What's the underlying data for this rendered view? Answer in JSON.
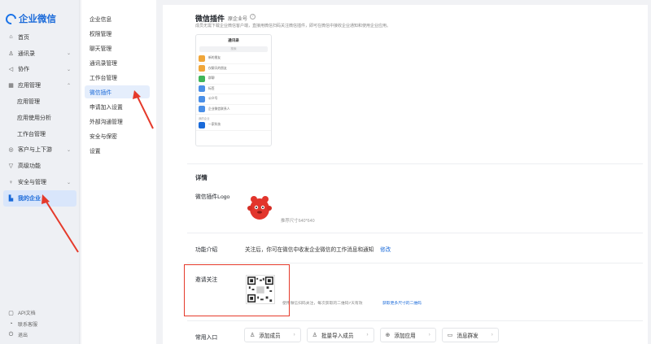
{
  "app": {
    "name": "企业微信"
  },
  "sidebar": {
    "items": [
      {
        "icon": "home-icon",
        "glyph": "⌂",
        "label": "首页"
      },
      {
        "icon": "contacts-icon",
        "glyph": "♙",
        "label": "通讯录",
        "chevron": "⌄"
      },
      {
        "icon": "collab-icon",
        "glyph": "◁",
        "label": "协作",
        "chevron": "⌄"
      },
      {
        "icon": "apps-icon",
        "glyph": "▦",
        "label": "应用管理",
        "chevron": "⌃"
      },
      {
        "label": "应用管理",
        "sub": true
      },
      {
        "label": "应用使用分析",
        "sub": true
      },
      {
        "label": "工作台管理",
        "sub": true
      },
      {
        "icon": "customer-icon",
        "glyph": "◎",
        "label": "客户与上下游",
        "chevron": "⌄"
      },
      {
        "icon": "advanced-icon",
        "glyph": "▽",
        "label": "高级功能"
      },
      {
        "icon": "security-icon",
        "glyph": "♀",
        "label": "安全与管理",
        "chevron": "⌄"
      },
      {
        "icon": "my-company-icon",
        "glyph": "▙",
        "label": "我的企业",
        "active": true
      }
    ],
    "bottom": [
      {
        "icon": "api-doc-icon",
        "glyph": "▢",
        "label": "API文档"
      },
      {
        "icon": "support-icon",
        "glyph": "◔",
        "label": "联系客服"
      },
      {
        "icon": "logout-icon",
        "glyph": "⏻",
        "label": "退出"
      }
    ]
  },
  "subnav": {
    "items": [
      {
        "label": "企业信息"
      },
      {
        "label": "权限管理"
      },
      {
        "label": "聊天管理"
      },
      {
        "label": "通讯录管理"
      },
      {
        "label": "工作台管理"
      },
      {
        "label": "微信插件",
        "active": true
      },
      {
        "label": "申请加入设置"
      },
      {
        "label": "外部沟通管理"
      },
      {
        "label": "安全与保密"
      },
      {
        "label": "设置"
      }
    ]
  },
  "plugin": {
    "title": "微信插件",
    "badge": "原企业号",
    "description": "成员无需下载企业微信客户端，直接用微信扫码关注微信插件，即可在微信中接收企业通知和使用企业应用。"
  },
  "phone_preview": {
    "title": "通讯录",
    "search": "搜索",
    "rows": [
      {
        "label": "新的朋友",
        "color": "#f0a63a"
      },
      {
        "label": "仅聊天的朋友",
        "color": "#f0a63a"
      },
      {
        "label": "群聊",
        "color": "#3fb65a"
      },
      {
        "label": "标签",
        "color": "#4a8fe7"
      },
      {
        "label": "公众号",
        "color": "#4a8fe7"
      },
      {
        "label": "企业微信联系人",
        "color": "#4a8fe7"
      }
    ],
    "section": "我的企业",
    "company_row": "一家科技"
  },
  "details": {
    "heading": "详情",
    "logo_label": "微信插件Logo",
    "logo_hint": "推荐尺寸640*640",
    "intro_label": "功能介绍",
    "intro_text": "关注后，你可在微信中收发企业微信的工作消息和通知",
    "intro_edit": "修改",
    "follow_label": "邀请关注",
    "qr_hint": "使用微信扫码关注，每次获取的二维码7天有效",
    "qr_link": "获取更多尺寸的二维码",
    "entry_label": "常用入口",
    "entries": [
      {
        "icon": "add-member-icon",
        "glyph": "♙",
        "label": "添加成员"
      },
      {
        "icon": "bulk-import-icon",
        "glyph": "♙",
        "label": "批量导入成员"
      },
      {
        "icon": "add-app-icon",
        "glyph": "⊕",
        "label": "添加应用"
      },
      {
        "icon": "broadcast-icon",
        "glyph": "▭",
        "label": "消息群发"
      }
    ]
  },
  "colors": {
    "accent": "#1a6ad9",
    "annotation": "#e53a2b",
    "active_bg": "#d9e6fb"
  }
}
